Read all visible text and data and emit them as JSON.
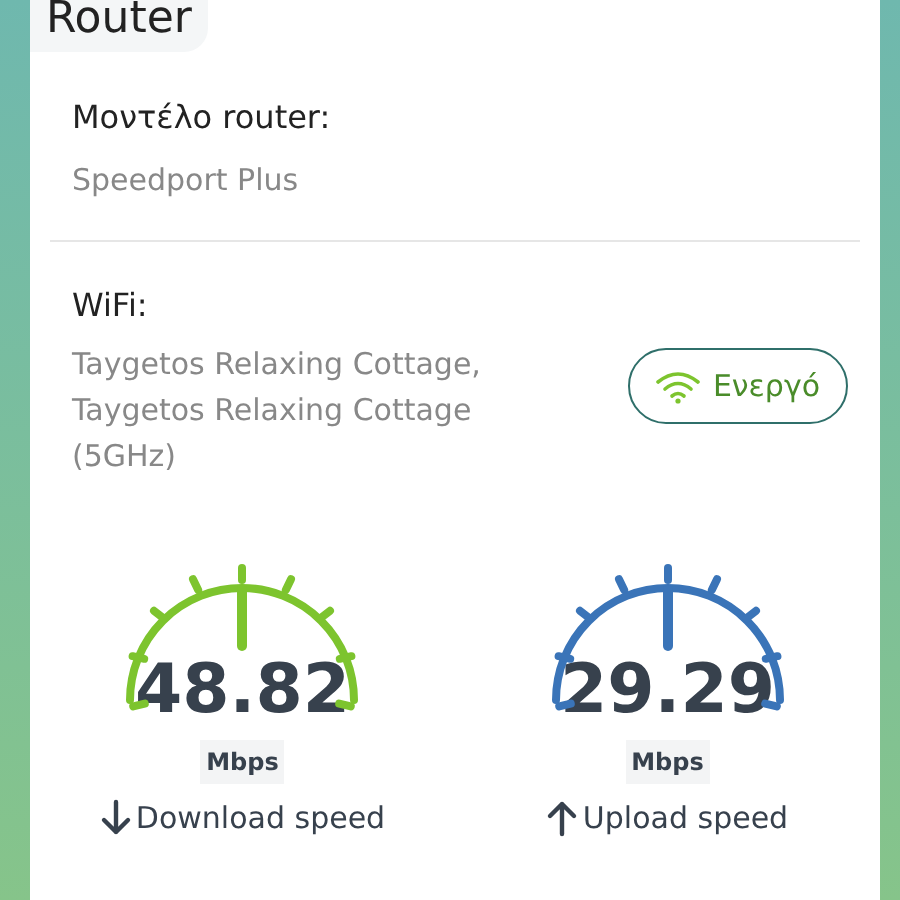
{
  "header": {
    "title": "Router"
  },
  "router_model": {
    "label": "Μοντέλο router:",
    "value": "Speedport Plus"
  },
  "wifi": {
    "label": "WiFi:",
    "value": "Taygetos Relaxing Cottage, Taygetos Relaxing Cottage (5GHz)",
    "status": "Ενεργό",
    "on": true
  },
  "speeds": [
    {
      "kind": "download",
      "value": "48.82",
      "unit": "Mbps",
      "label": "Download speed",
      "color": "#7dc42e"
    },
    {
      "kind": "upload",
      "value": "29.29",
      "unit": "Mbps",
      "label": "Upload speed",
      "color": "#3a74b8"
    }
  ]
}
